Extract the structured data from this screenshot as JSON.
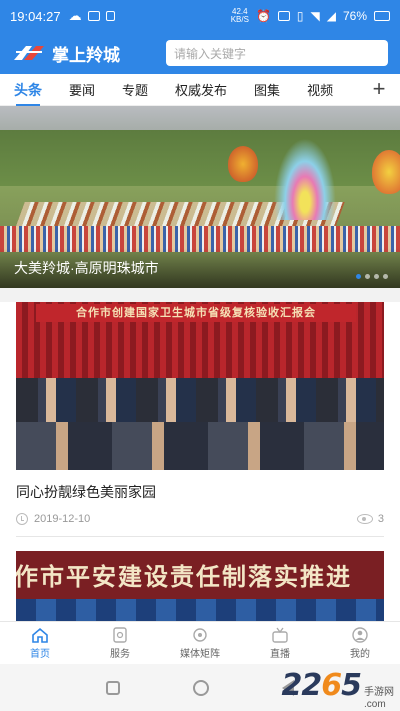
{
  "status_bar": {
    "time": "19:04:27",
    "net_speed_value": "42.4",
    "net_speed_unit": "KB/S",
    "battery": "76%"
  },
  "header": {
    "app_name": "掌上羚城",
    "search_placeholder": "请输入关键字",
    "brand_color": "#2f86e6"
  },
  "tabs": [
    {
      "label": "头条",
      "active": true
    },
    {
      "label": "要闻",
      "active": false
    },
    {
      "label": "专题",
      "active": false
    },
    {
      "label": "权威发布",
      "active": false
    },
    {
      "label": "图集",
      "active": false
    },
    {
      "label": "视频",
      "active": false
    }
  ],
  "banner": {
    "caption": "大美羚城·高原明珠城市",
    "slide_count": 4,
    "active_slide": 1
  },
  "news": [
    {
      "image_banner_text": "合作市创建国家卫生城市省级复核验收汇报会",
      "title": "同心扮靓绿色美丽家园",
      "date": "2019-12-10",
      "views": "3"
    },
    {
      "image_banner_text": "作市平安建设责任制落实推进"
    }
  ],
  "bottom_nav": [
    {
      "label": "首页",
      "icon": "home-icon",
      "active": true
    },
    {
      "label": "服务",
      "icon": "service-icon",
      "active": false
    },
    {
      "label": "媒体矩阵",
      "icon": "media-matrix-icon",
      "active": false
    },
    {
      "label": "直播",
      "icon": "live-icon",
      "active": false
    },
    {
      "label": "我的",
      "icon": "profile-icon",
      "active": false
    }
  ],
  "watermark": {
    "number_a": "22",
    "number_b": "6",
    "number_c": "5",
    "text_top": "手游网",
    "text_bottom": ".com"
  }
}
